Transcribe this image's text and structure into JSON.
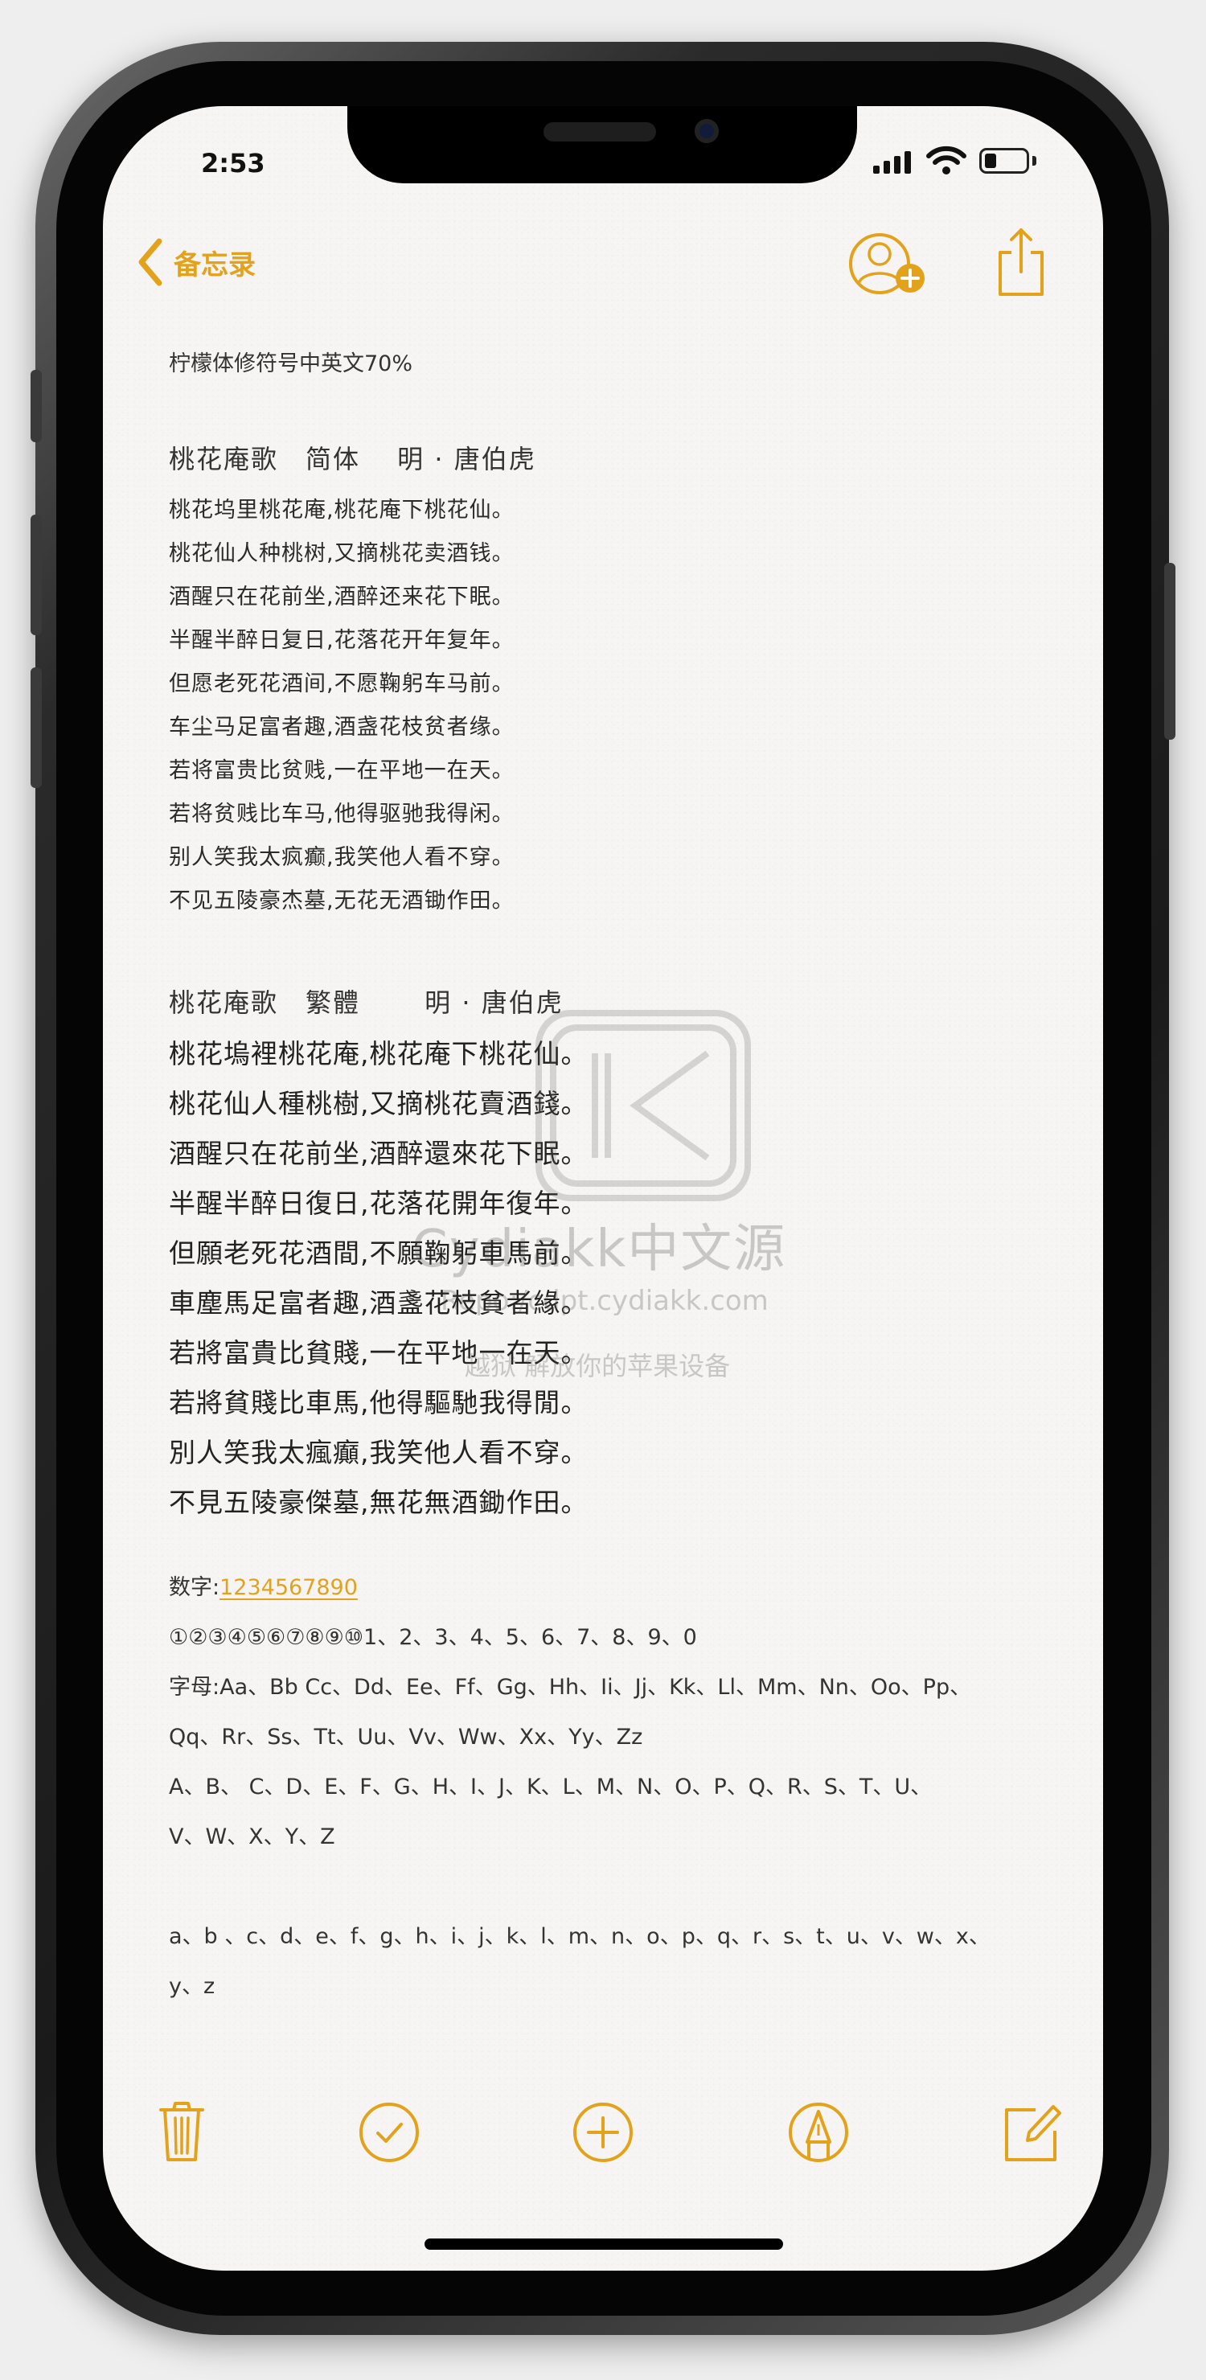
{
  "status": {
    "time": "2:53"
  },
  "nav": {
    "back_label": "备忘录"
  },
  "note": {
    "header": "柠檬体修符号中英文70%",
    "poem_simplified": {
      "title": "桃花庵歌　简体　 明 · 唐伯虎",
      "lines": [
        "桃花坞里桃花庵,桃花庵下桃花仙。",
        "桃花仙人种桃树,又摘桃花卖酒钱。",
        "酒醒只在花前坐,酒醉还来花下眠。",
        "半醒半醉日复日,花落花开年复年。",
        "但愿老死花酒间,不愿鞠躬车马前。",
        "车尘马足富者趣,酒盏花枝贫者缘。",
        "若将富贵比贫贱,一在平地一在天。",
        "若将贫贱比车马,他得驱驰我得闲。",
        "别人笑我太疯癫,我笑他人看不穿。",
        "不见五陵豪杰墓,无花无酒锄作田。"
      ]
    },
    "poem_traditional": {
      "title": "桃花庵歌　繁體　　 明 · 唐伯虎",
      "lines": [
        "桃花塢裡桃花庵,桃花庵下桃花仙。",
        "桃花仙人種桃樹,又摘桃花賣酒錢。",
        "酒醒只在花前坐,酒醉還來花下眠。",
        "半醒半醉日復日,花落花開年復年。",
        "但願老死花酒間,不願鞠躬車馬前。",
        "車塵馬足富者趣,酒盞花枝貧者緣。",
        "若將富貴比貧賤,一在平地一在天。",
        "若將貧賤比車馬,他得驅馳我得閒。",
        "別人笑我太瘋癲,我笑他人看不穿。",
        "不見五陵豪傑墓,無花無酒鋤作田。"
      ]
    },
    "digits_label": "数字:",
    "digits_link": "1234567890",
    "circled_numbers": "①②③④⑤⑥⑦⑧⑨⑩1、2、3、4、5、6、7、8、9、0",
    "letters_label_line1": "字母:Aa、Bb Cc、Dd、Ee、Ff、Gg、Hh、Ii、Jj、Kk、Ll、Mm、Nn、Oo、Pp、",
    "letters_line2": "Qq、Rr、Ss、Tt、Uu、Vv、Ww、Xx、Yy、Zz",
    "upper_line1": "A、B、 C、D、E、F、G、H、I、J、K、L、M、N、O、P、Q、R、S、T、U、",
    "upper_line2": "V、W、X、Y、Z",
    "lower_line1": "a、b 、c、d、e、f、g、h、i、j、k、l、m、n、o、p、q、r、s、t、u、v、w、x、",
    "lower_line2": "y、z"
  },
  "watermark": {
    "brand": "Cydiakk中文源",
    "url": "Repo:/cdpt.cydiakk.com",
    "slogan": "越狱 解放你的苹果设备"
  },
  "colors": {
    "accent": "#e2a21c",
    "paper": "#f6f5f3"
  }
}
